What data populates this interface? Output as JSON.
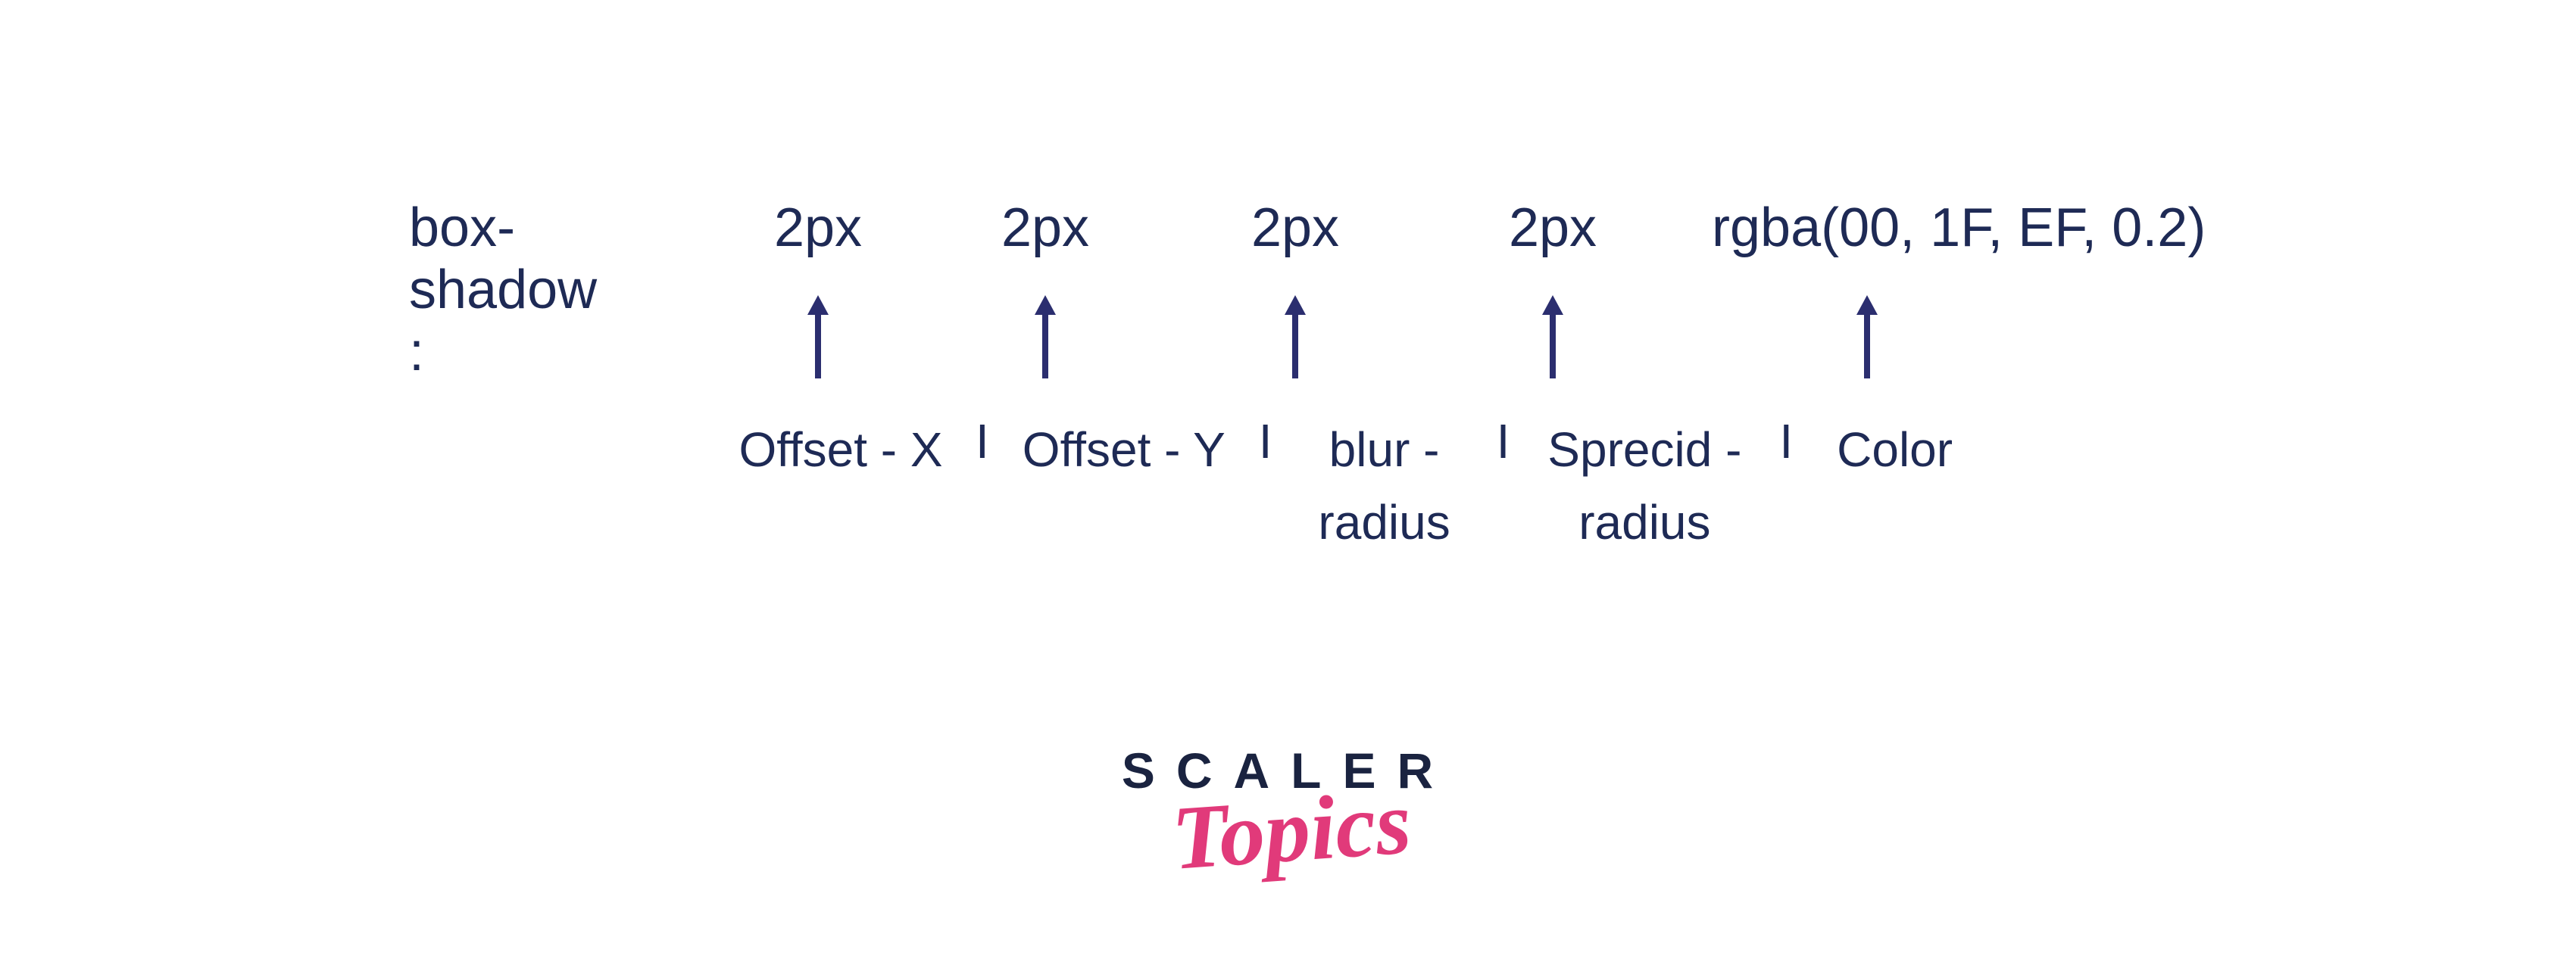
{
  "syntax": {
    "property": "box-shadow :",
    "values": [
      "2px",
      "2px",
      "2px",
      "2px",
      "rgba(00, 1F, EF, 0.2)"
    ],
    "labels": [
      "Offset - X",
      "Offset - Y",
      "blur - radius",
      "Sprecid - radius",
      "Color"
    ],
    "separator": "I"
  },
  "logo": {
    "line1": "SCALER",
    "line2": "Topics"
  },
  "colors": {
    "text": "#1e2a55",
    "logoDark": "#1a2340",
    "logoPink": "#e13a7a"
  }
}
